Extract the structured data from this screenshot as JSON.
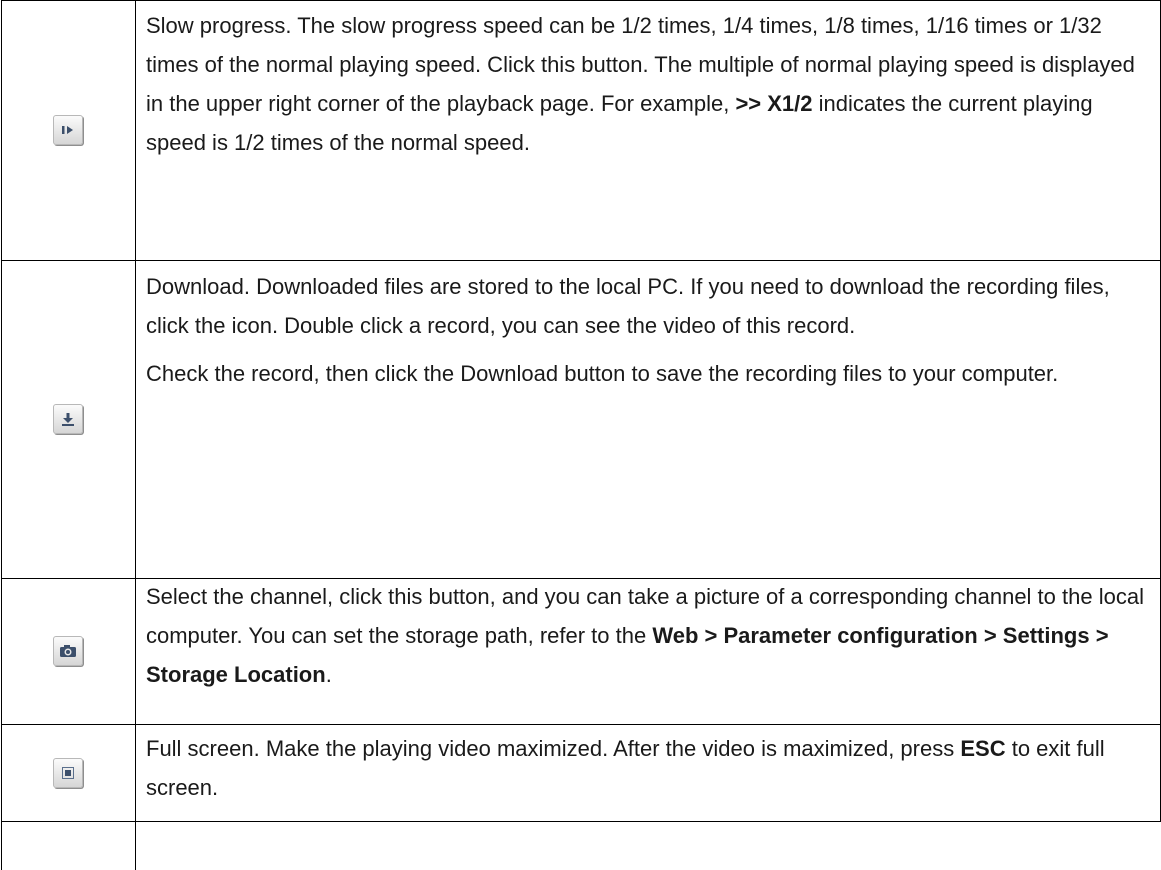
{
  "rows": [
    {
      "icon": "slow-play-icon",
      "text": "Slow progress. The slow progress speed can be 1/2 times, 1/4 times, 1/8 times, 1/16 times or 1/32 times of the normal playing speed. Click this button. The multiple of normal playing speed is displayed in the upper right corner of the playback page. For example, ",
      "bold": ">> X1/2",
      "text_end": " indicates the current playing speed is 1/2 times of the normal speed."
    },
    {
      "icon": "download-icon",
      "text": "Download. Downloaded files are stored to the local PC. If you need to download the recording files, click the icon. Double click a record, you can see the video of this record.",
      "text2": "Check the record, then click the Download button to save the recording files to your computer."
    },
    {
      "icon": "camera-icon",
      "text": "Select the channel, click this button, and you can take a picture of a corresponding channel to the local computer. You can set the storage path, refer to the ",
      "bold": "Web > Parameter configuration > Settings > Storage Location",
      "text_end": "."
    },
    {
      "icon": "fullscreen-icon",
      "text": "Full screen. Make the playing video maximized. After the video is maximized, press ",
      "bold": "ESC",
      "text_end": " to exit full screen."
    }
  ]
}
